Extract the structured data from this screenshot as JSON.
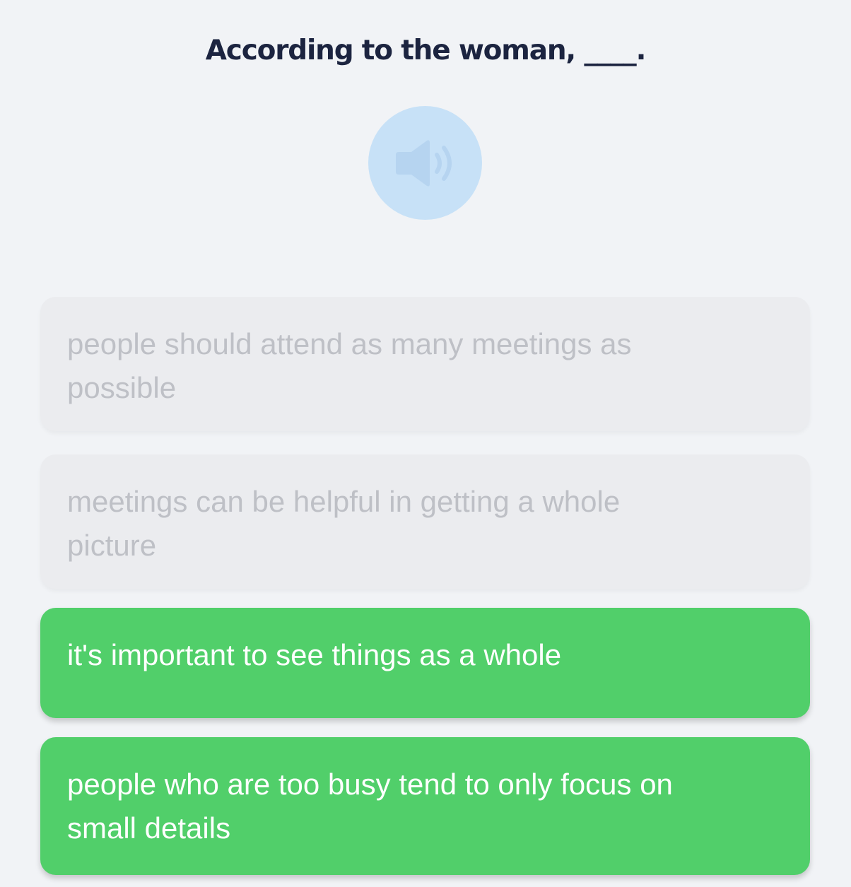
{
  "question": {
    "text": "According to the woman, ____."
  },
  "audio_button": {
    "icon": "speaker-icon",
    "color": "#c7e1f7"
  },
  "options": [
    {
      "label": "people should attend as many meetings as possible",
      "state": "disabled"
    },
    {
      "label": "meetings can be helpful in getting a whole picture",
      "state": "disabled"
    },
    {
      "label": "it's important to see things as a whole",
      "state": "correct"
    },
    {
      "label": "people who are too busy tend to only focus on small details",
      "state": "correct"
    }
  ],
  "colors": {
    "background": "#f1f3f6",
    "title": "#1c2440",
    "correct": "#51cf6a",
    "disabled_bg": "#ebecef",
    "disabled_text": "#bec0c6"
  }
}
